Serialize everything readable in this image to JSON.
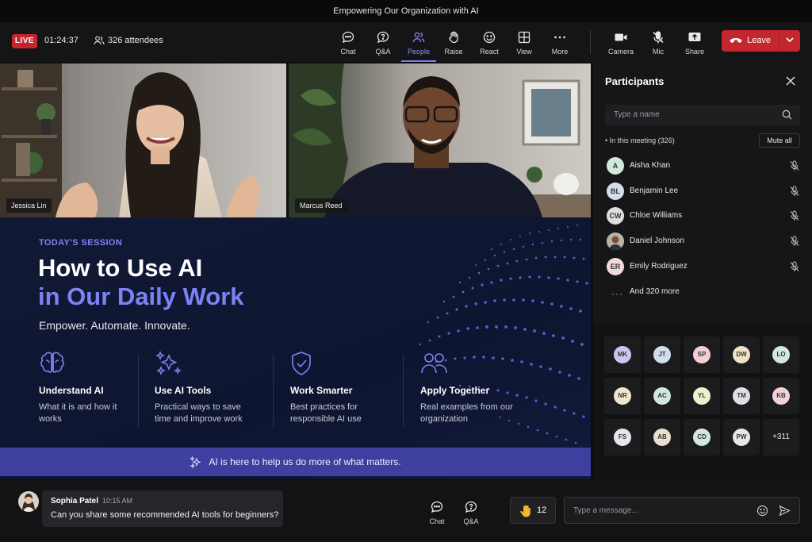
{
  "window_title": "Empowering Our Organization with AI",
  "top": {
    "live_label": "LIVE",
    "timer": "01:24:37",
    "attendees": "326 attendees",
    "controls": [
      {
        "label": "Chat",
        "icon": "chat-icon"
      },
      {
        "label": "Q&A",
        "icon": "qa-icon"
      },
      {
        "label": "People",
        "icon": "people-icon",
        "active": true
      },
      {
        "label": "Raise",
        "icon": "raise-hand-icon"
      },
      {
        "label": "React",
        "icon": "react-icon"
      },
      {
        "label": "View",
        "icon": "view-icon"
      },
      {
        "label": "More",
        "icon": "more-icon"
      },
      {
        "label": "Camera",
        "icon": "camera-icon"
      },
      {
        "label": "Mic",
        "icon": "mic-off-icon"
      },
      {
        "label": "Share",
        "icon": "share-icon"
      }
    ],
    "leave_label": "Leave"
  },
  "videos": [
    {
      "name": "Jessica Lin"
    },
    {
      "name": "Marcus Reed"
    }
  ],
  "slide": {
    "tag": "TODAY'S SESSION",
    "title_line1": "How to Use AI",
    "title_line2": "in Our Daily Work",
    "subtitle": "Empower. Automate. Innovate.",
    "features": [
      {
        "title": "Understand AI",
        "desc": "What it is and how it works",
        "icon": "brain-icon"
      },
      {
        "title": "Use AI Tools",
        "desc": "Practical ways to save time and improve work",
        "icon": "sparkles-icon"
      },
      {
        "title": "Work Smarter",
        "desc": "Best practices for responsible AI use",
        "icon": "shield-check-icon"
      },
      {
        "title": "Apply Together",
        "desc": "Real examples from our organization",
        "icon": "group-icon"
      }
    ],
    "banner": "AI is here to help us do more of what matters."
  },
  "participants": {
    "title": "Participants",
    "search_placeholder": "Type a name",
    "in_meeting": "• In this meeting (326)",
    "mute_all": "Mute all",
    "list": [
      {
        "initials": "A",
        "name": "Aisha Khan",
        "color": "#cfe9dc"
      },
      {
        "initials": "BL",
        "name": "Benjamin Lee",
        "color": "#d8dcef"
      },
      {
        "initials": "CW",
        "name": "Chloe Williams",
        "color": "#dedede"
      },
      {
        "initials": "",
        "name": "Daniel Johnson",
        "color": "#8a6a5a"
      },
      {
        "initials": "ER",
        "name": "Emily Rodriguez",
        "color": "#f3dada"
      }
    ],
    "more": "And 320 more",
    "grid": [
      {
        "initials": "MK",
        "color": "#c9c7f2"
      },
      {
        "initials": "JT",
        "color": "#cfe0ec"
      },
      {
        "initials": "SP",
        "color": "#f3cfd2"
      },
      {
        "initials": "DW",
        "color": "#f1e2c6"
      },
      {
        "initials": "LO",
        "color": "#cfeadc"
      },
      {
        "initials": "NR",
        "color": "#f1e4cc"
      },
      {
        "initials": "AC",
        "color": "#cfe9dc"
      },
      {
        "initials": "YL",
        "color": "#eef0cf"
      },
      {
        "initials": "TM",
        "color": "#dde0e5"
      },
      {
        "initials": "KB",
        "color": "#f1d3d6"
      },
      {
        "initials": "FS",
        "color": "#e4e6ea"
      },
      {
        "initials": "AB",
        "color": "#eadfcf"
      },
      {
        "initials": "CD",
        "color": "#cfe9dc"
      },
      {
        "initials": "PW",
        "color": "#e6e6e6"
      }
    ],
    "grid_more": "+311"
  },
  "chat": {
    "sender": "Sophia Patel",
    "time": "10:15 AM",
    "message": "Can you share some recommended AI tools for beginners?"
  },
  "bottom": {
    "chat_label": "Chat",
    "qa_label": "Q&A",
    "hand_count": "12",
    "message_placeholder": "Type a message..."
  }
}
